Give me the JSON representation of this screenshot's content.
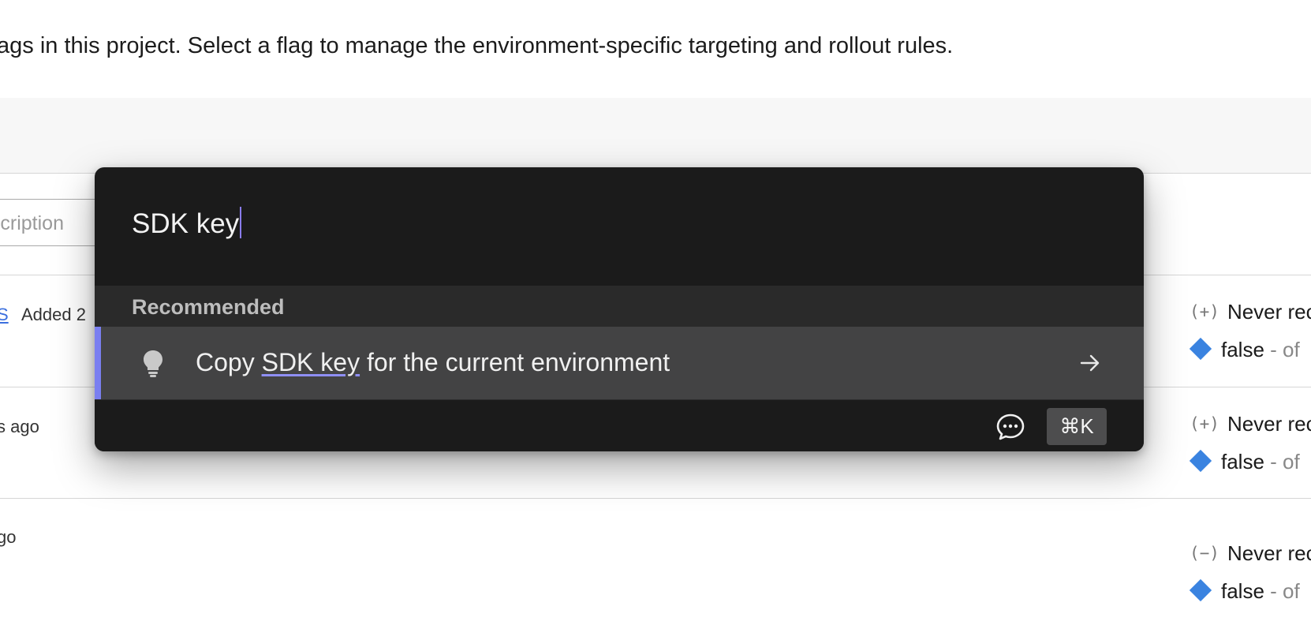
{
  "page": {
    "intro_text": "ags in this project. Select a flag to manage the environment-specific targeting and rollout rules.",
    "search_placeholder": "escription"
  },
  "rows": [
    {
      "link_text": "S",
      "meta": "Added 2",
      "status_symbol": "(+)",
      "status_text": "Never rec",
      "value": "false",
      "value_suffix": " - of"
    },
    {
      "meta": "s ago",
      "status_symbol": "(+)",
      "status_text": "Never rec",
      "value": "false",
      "value_suffix": " - of"
    },
    {
      "meta": "go",
      "status_symbol": "(−)",
      "status_text": "Never rec",
      "value": "false",
      "value_suffix": " - of"
    }
  ],
  "palette": {
    "query": "SDK key",
    "section_label": "Recommended",
    "option": {
      "prefix": "Copy ",
      "highlight": "SDK key",
      "suffix": " for the current environment",
      "icon": "lightbulb-icon"
    },
    "shortcut": "⌘K",
    "footer_icon": "chat-bubble-icon"
  },
  "colors": {
    "palette_bg": "#1b1b1b",
    "option_bg": "#434344",
    "accent": "#7a7ff0",
    "diamond": "#3a83e0",
    "link": "#3b6fde"
  }
}
